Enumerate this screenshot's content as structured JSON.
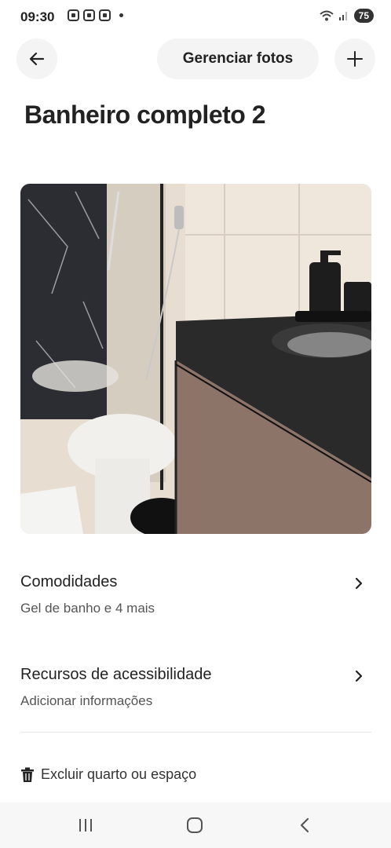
{
  "status_bar": {
    "time": "09:30",
    "battery": "75"
  },
  "top_bar": {
    "manage_photos_label": "Gerenciar fotos"
  },
  "page": {
    "title": "Banheiro completo 2"
  },
  "sections": [
    {
      "title": "Comodidades",
      "subtitle": "Gel de banho e 4 mais"
    },
    {
      "title": "Recursos de acessibilidade",
      "subtitle": "Adicionar informações"
    }
  ],
  "delete_label": "Excluir quarto ou espaço",
  "icons": {
    "back": "arrow-left-icon",
    "add": "plus-icon",
    "chevron": "chevron-right-icon",
    "trash": "trash-icon"
  }
}
